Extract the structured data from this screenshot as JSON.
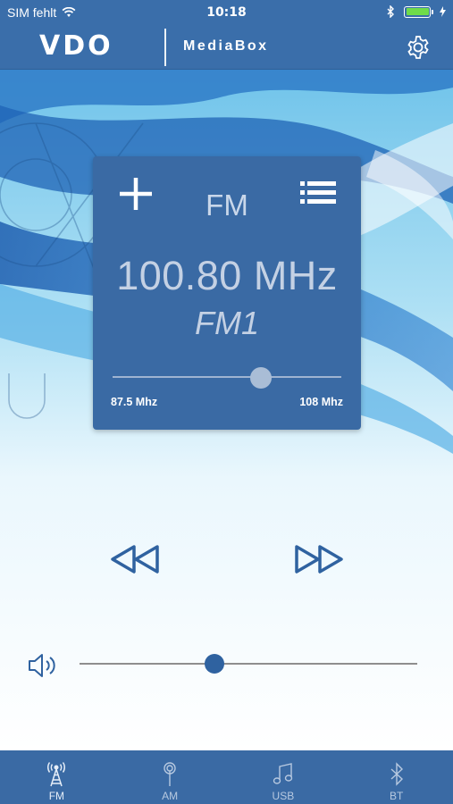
{
  "status_bar": {
    "carrier": "SIM fehlt",
    "time": "10:18",
    "wifi_icon": "wifi-icon",
    "bluetooth_icon": "bluetooth-icon",
    "battery_level": 1.0,
    "battery_color": "#6fdc4a"
  },
  "header": {
    "brand": "VDO",
    "product": "MediaBox",
    "settings_icon": "gear-icon"
  },
  "colors": {
    "accent": "#3a6aa4",
    "header": "#3a6eaa",
    "thumb_volume": "#2f62a0"
  },
  "tuner": {
    "band": "FM",
    "frequency": "100.80 MHz",
    "preset": "FM1",
    "add_icon": "plus-icon",
    "list_icon": "list-icon",
    "range_min_label": "87.5 Mhz",
    "range_max_label": "108 Mhz",
    "range_min": 87.5,
    "range_max": 108.0,
    "current": 100.8
  },
  "transport": {
    "rewind_icon": "rewind-icon",
    "forward_icon": "fast-forward-icon"
  },
  "volume": {
    "icon": "speaker-icon",
    "level": 0.4
  },
  "tabs": [
    {
      "label": "FM",
      "icon": "fm-tower-icon",
      "active": true
    },
    {
      "label": "AM",
      "icon": "am-antenna-icon",
      "active": false
    },
    {
      "label": "USB",
      "icon": "music-note-icon",
      "active": false
    },
    {
      "label": "BT",
      "icon": "bluetooth-icon",
      "active": false
    }
  ]
}
